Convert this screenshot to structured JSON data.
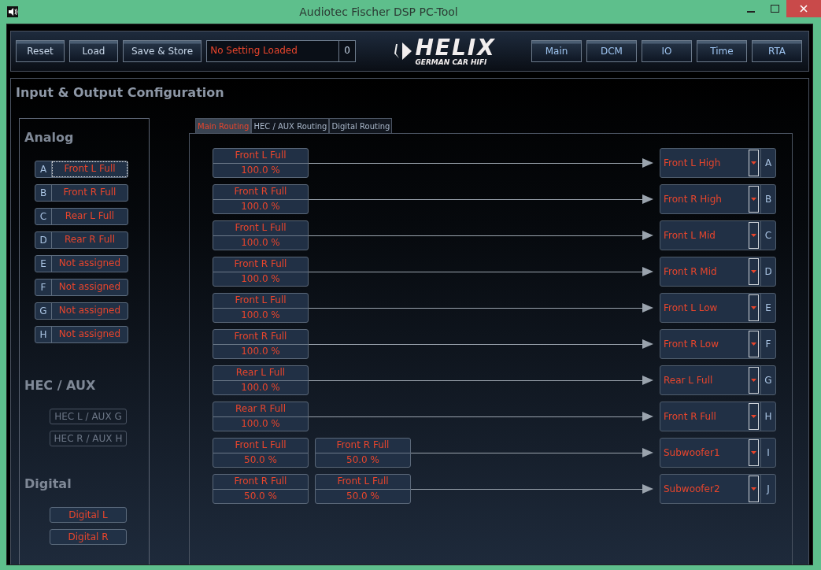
{
  "window": {
    "title": "Audiotec Fischer DSP PC-Tool"
  },
  "toolbar": {
    "buttons": [
      "Reset",
      "Load",
      "Save & Store"
    ],
    "setting": {
      "name": "No Setting Loaded",
      "number": "0"
    },
    "logo": {
      "name": "HELIX",
      "tagline": "GERMAN CAR HIFI"
    },
    "nav": [
      "Main",
      "DCM",
      "IO",
      "Time",
      "RTA"
    ]
  },
  "page": {
    "title": "Input & Output Configuration"
  },
  "inputs": [
    {
      "title": "Analog",
      "kind": "lettered",
      "items": [
        {
          "letter": "A",
          "label": "Front L Full",
          "focused": true
        },
        {
          "letter": "B",
          "label": "Front R Full",
          "focused": false
        },
        {
          "letter": "C",
          "label": "Rear L Full",
          "focused": false
        },
        {
          "letter": "D",
          "label": "Rear R Full",
          "focused": false
        },
        {
          "letter": "E",
          "label": "Not assigned",
          "focused": false
        },
        {
          "letter": "F",
          "label": "Not assigned",
          "focused": false
        },
        {
          "letter": "G",
          "label": "Not assigned",
          "focused": false
        },
        {
          "letter": "H",
          "label": "Not assigned",
          "focused": false
        }
      ]
    },
    {
      "title": "HEC / AUX",
      "kind": "plain",
      "items": [
        {
          "label": "HEC L / AUX G",
          "disabled": true
        },
        {
          "label": "HEC R / AUX H",
          "disabled": true
        }
      ]
    },
    {
      "title": "Digital",
      "kind": "plain",
      "items": [
        {
          "label": "Digital L",
          "disabled": false
        },
        {
          "label": "Digital R",
          "disabled": false
        }
      ]
    }
  ],
  "tabs": [
    {
      "label": "Main Routing",
      "selected": true
    },
    {
      "label": "HEC / AUX Routing",
      "selected": false
    },
    {
      "label": "Digital Routing",
      "selected": false
    }
  ],
  "routes": [
    {
      "sources": [
        {
          "name": "Front L Full",
          "gain": "100.0 %"
        }
      ],
      "output": "Front L High",
      "channel": "A"
    },
    {
      "sources": [
        {
          "name": "Front R Full",
          "gain": "100.0 %"
        }
      ],
      "output": "Front R High",
      "channel": "B"
    },
    {
      "sources": [
        {
          "name": "Front L Full",
          "gain": "100.0 %"
        }
      ],
      "output": "Front L Mid",
      "channel": "C"
    },
    {
      "sources": [
        {
          "name": "Front R Full",
          "gain": "100.0 %"
        }
      ],
      "output": "Front R Mid",
      "channel": "D"
    },
    {
      "sources": [
        {
          "name": "Front L Full",
          "gain": "100.0 %"
        }
      ],
      "output": "Front L Low",
      "channel": "E"
    },
    {
      "sources": [
        {
          "name": "Front R Full",
          "gain": "100.0 %"
        }
      ],
      "output": "Front R Low",
      "channel": "F"
    },
    {
      "sources": [
        {
          "name": "Rear L Full",
          "gain": "100.0 %"
        }
      ],
      "output": "Rear L Full",
      "channel": "G"
    },
    {
      "sources": [
        {
          "name": "Rear R Full",
          "gain": "100.0 %"
        }
      ],
      "output": "Front R Full",
      "channel": "H"
    },
    {
      "sources": [
        {
          "name": "Front L Full",
          "gain": "50.0 %"
        },
        {
          "name": "Front R Full",
          "gain": "50.0 %"
        }
      ],
      "output": "Subwoofer1",
      "channel": "I"
    },
    {
      "sources": [
        {
          "name": "Front R Full",
          "gain": "50.0 %"
        },
        {
          "name": "Front L Full",
          "gain": "50.0 %"
        }
      ],
      "output": "Subwoofer2",
      "channel": "J"
    }
  ]
}
